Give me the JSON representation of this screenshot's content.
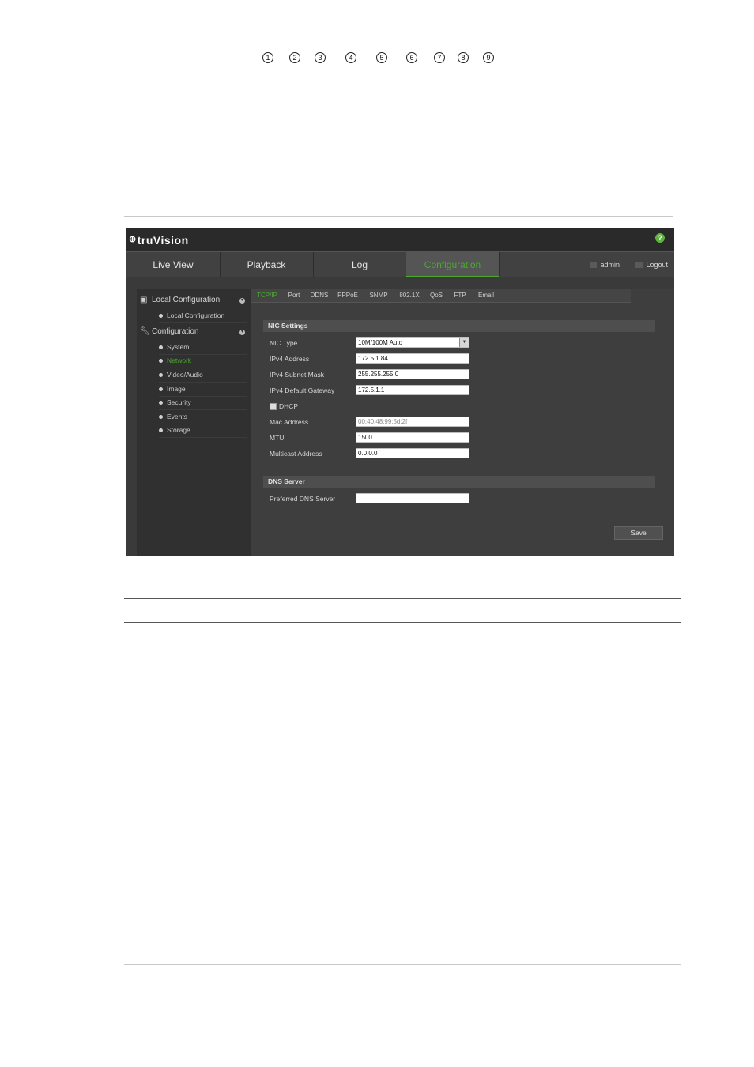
{
  "app": {
    "logo": "truVision",
    "nav": [
      "Live View",
      "Playback",
      "Log",
      "Configuration"
    ],
    "active_nav": "Configuration",
    "user": "admin",
    "logout": "Logout",
    "help_glyph": "?"
  },
  "sidebar": {
    "local_configuration": "Local Configuration",
    "local_items": [
      "Local Configuration"
    ],
    "configuration": "Configuration",
    "config_items": [
      "System",
      "Network",
      "Video/Audio",
      "Image",
      "Security",
      "Events",
      "Storage"
    ],
    "active_item": "Network"
  },
  "subtabs": [
    "TCP/IP",
    "Port",
    "DDNS",
    "PPPoE",
    "SNMP",
    "802.1X",
    "QoS",
    "FTP",
    "Email"
  ],
  "callouts": [
    "1",
    "2",
    "3",
    "4",
    "5",
    "6",
    "7",
    "8",
    "9"
  ],
  "nic_settings": {
    "title": "NIC Settings",
    "nic_type_label": "NIC Type",
    "nic_type_value": "10M/100M Auto",
    "ipv4_address_label": "IPv4 Address",
    "ipv4_address_value": "172.5.1.84",
    "ipv4_subnet_label": "IPv4 Subnet Mask",
    "ipv4_subnet_value": "255.255.255.0",
    "ipv4_gateway_label": "IPv4 Default Gateway",
    "ipv4_gateway_value": "172.5.1.1",
    "dhcp_label": "DHCP",
    "mac_label": "Mac Address",
    "mac_value": "00:40:48:99:5d:2f",
    "mtu_label": "MTU",
    "mtu_value": "1500",
    "multicast_label": "Multicast Address",
    "multicast_value": "0.0.0.0"
  },
  "dns": {
    "title": "DNS Server",
    "preferred_label": "Preferred DNS Server",
    "preferred_value": ""
  },
  "save_label": "Save"
}
